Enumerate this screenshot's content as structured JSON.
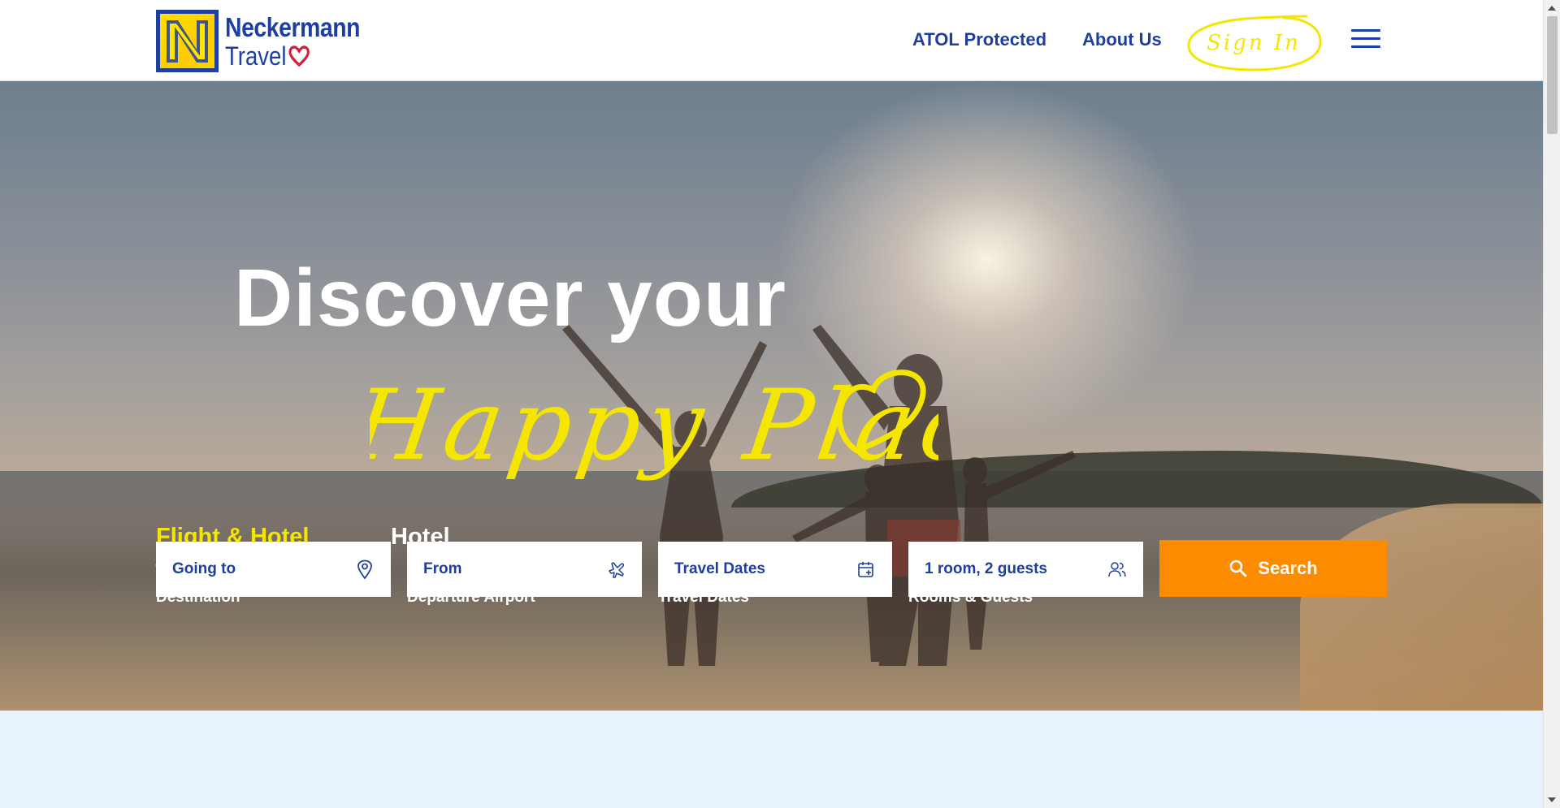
{
  "brand": {
    "name_line1": "Neckermann",
    "name_line2": "Travel"
  },
  "nav": {
    "atol": "ATOL Protected",
    "about": "About Us",
    "signin": "Sign In"
  },
  "hero": {
    "headline": "Discover your",
    "tagline": "Happy Place"
  },
  "search": {
    "tabs": [
      {
        "label": "Flight & Hotel",
        "active": true
      },
      {
        "label": "Hotel",
        "active": false
      }
    ],
    "fields": [
      {
        "label": "Destination",
        "placeholder": "Going to",
        "icon": "map-pin-icon"
      },
      {
        "label": "Departure Airport",
        "placeholder": "From",
        "icon": "airplane-icon"
      },
      {
        "label": "Travel Dates",
        "placeholder": "Travel Dates",
        "icon": "calendar-icon"
      },
      {
        "label": "Rooms & Guests",
        "placeholder": "1 room, 2 guests",
        "icon": "guests-icon"
      }
    ],
    "button": "Search"
  },
  "colors": {
    "brand_blue": "#1e3f9e",
    "brand_yellow": "#f5e600",
    "search_orange": "#fd8b00",
    "section_bg": "#e8f2fd"
  }
}
